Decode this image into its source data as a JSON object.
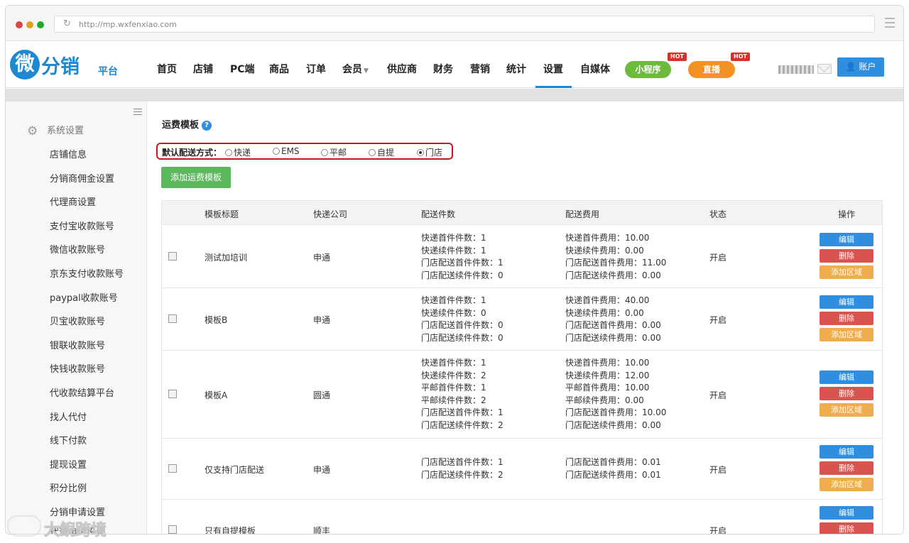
{
  "browser": {
    "url": "http://mp.wxfenxiao.com"
  },
  "brand": {
    "mark": "微",
    "name": "分销",
    "sub": "平台"
  },
  "nav": {
    "items": [
      "首页",
      "店铺",
      "PC端",
      "商品",
      "订单",
      "会员",
      "供应商",
      "财务",
      "营销",
      "统计",
      "设置",
      "自媒体"
    ],
    "active": "设置",
    "mini_program": "小程序",
    "live": "直播",
    "hot_badge": "HOT",
    "account": "账户",
    "colors": {
      "mini_program": "#6cbb3c",
      "live": "#f39222",
      "account": "#2f8ee0",
      "active_underline": "#1e88d0"
    }
  },
  "sidebar": {
    "header": "系统设置",
    "items": [
      "店铺信息",
      "分销商佣金设置",
      "代理商设置",
      "支付宝收款账号",
      "微信收款账号",
      "京东支付收款账号",
      "paypal收款账号",
      "贝宝收款账号",
      "银联收款账号",
      "快钱收款账号",
      "代收款结算平台",
      "找人代付",
      "线下付款",
      "提现设置",
      "积分比例",
      "分销申请设置",
      "代理申请设置"
    ]
  },
  "main": {
    "title": "运费模板",
    "default_shipping": {
      "label": "默认配送方式：",
      "options": [
        "快递",
        "EMS",
        "平邮",
        "自提",
        "门店"
      ],
      "selected": "门店"
    },
    "add_button": "添加运费模板",
    "table": {
      "headers": [
        "模板标题",
        "快递公司",
        "配送件数",
        "配送费用",
        "状态",
        "操作"
      ],
      "actions": {
        "edit": "编辑",
        "delete": "删除",
        "add_area": "添加区域"
      },
      "rows": [
        {
          "title": "测试加培训",
          "company": "申通",
          "counts": [
            "快递首件件数：1",
            "快递续件件数：1",
            "门店配送首件件数：1",
            "门店配送续件件数：0"
          ],
          "fees": [
            "快递首件费用：10.00",
            "快递续件费用：0.00",
            "门店配送首件费用：11.00",
            "门店配送续件费用：0.00"
          ],
          "status": "开启"
        },
        {
          "title": "模板B",
          "company": "申通",
          "counts": [
            "快递首件件数：1",
            "快递续件件数：0",
            "门店配送首件件数：0",
            "门店配送续件件数：0"
          ],
          "fees": [
            "快递首件费用：40.00",
            "快递续件费用：0.00",
            "门店配送首件费用：0.00",
            "门店配送续件费用：0.00"
          ],
          "status": "开启"
        },
        {
          "title": "模板A",
          "company": "圆通",
          "counts": [
            "快递首件件数：1",
            "快递续件件数：2",
            "平邮首件件数：1",
            "平邮续件件数：2",
            "门店配送首件件数：1",
            "门店配送续件件数：2"
          ],
          "fees": [
            "快递首件费用：10.00",
            "快递续件费用：12.00",
            "平邮首件费用：10.00",
            "平邮续件费用：0.00",
            "门店配送首件费用：10.00",
            "门店配送续件费用：0.00"
          ],
          "status": "开启"
        },
        {
          "title": "仅支持门店配送",
          "company": "申通",
          "counts": [
            "门店配送首件件数：1",
            "门店配送续件件数：2"
          ],
          "fees": [
            "门店配送首件费用：0.01",
            "门店配送续件费用：0.01"
          ],
          "status": "开启"
        },
        {
          "title": "只有自提模板",
          "company": "顺丰",
          "counts": [],
          "fees": [],
          "status": "开启"
        }
      ]
    }
  },
  "watermark": "大鲵跨境"
}
